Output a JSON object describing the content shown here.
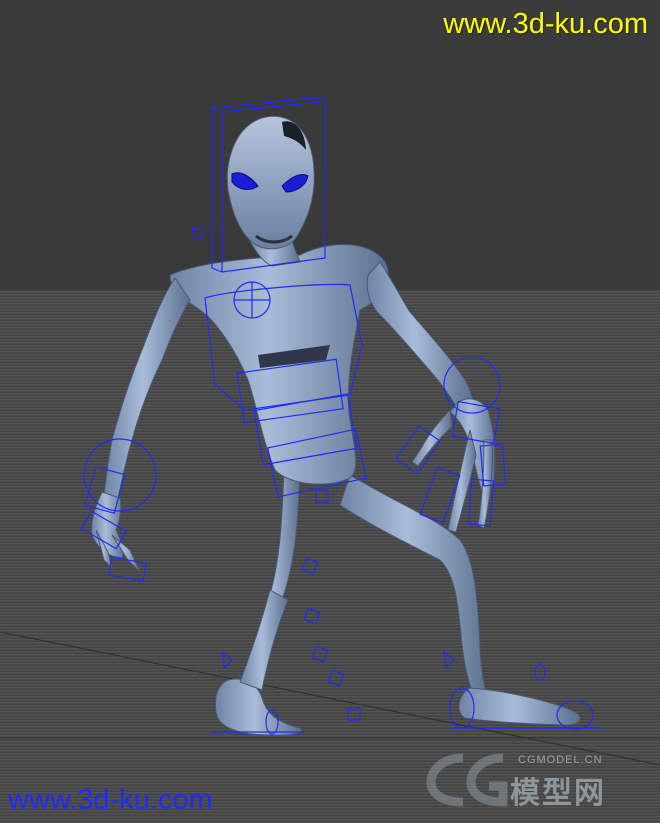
{
  "watermark": {
    "top_text": "www.3d-ku.com",
    "bottom_text": "www.3d-ku.com",
    "logo_small_text": "CGMODEL.CN",
    "logo_big_text": "模型网",
    "top_color": "#ffff00",
    "bottom_color": "#1f2bff"
  },
  "viewport": {
    "background_color": "#3a3a3a",
    "ground_color": "#4a4a4a",
    "model_color": "#8fa6c8",
    "rig_color": "#1f2bff"
  }
}
